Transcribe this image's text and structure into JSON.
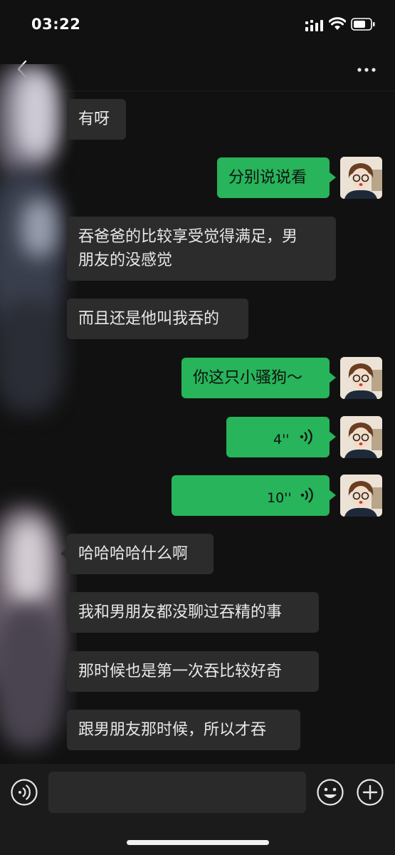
{
  "status": {
    "time": "03:22"
  },
  "messages": [
    {
      "side": "in",
      "text": "有呀"
    },
    {
      "side": "out",
      "text": "分别说说看"
    },
    {
      "side": "in",
      "line1": "吞爸爸的比较享受觉得满足，男",
      "line2": "朋友的没感觉"
    },
    {
      "side": "in",
      "text": "而且还是他叫我吞的"
    },
    {
      "side": "out",
      "text": "你这只小骚狗～"
    },
    {
      "side": "out",
      "type": "voice",
      "duration": "4''"
    },
    {
      "side": "out",
      "type": "voice",
      "duration": "10''"
    },
    {
      "side": "in",
      "text": "哈哈哈哈什么啊"
    },
    {
      "side": "in",
      "text": "我和男朋友都没聊过吞精的事"
    },
    {
      "side": "in",
      "text": "那时候也是第一次吞比较好奇"
    },
    {
      "side": "in",
      "text": "跟男朋友那时候，所以才吞"
    }
  ],
  "colors": {
    "outgoing_bubble": "#27b45a",
    "incoming_bubble": "#2c2c2c",
    "background": "#111111"
  },
  "icons": {
    "back": "chevron-left-icon",
    "more": "ellipsis-icon",
    "voice_toggle": "voice-icon",
    "emoji": "smiley-icon",
    "add": "plus-circle-icon"
  }
}
